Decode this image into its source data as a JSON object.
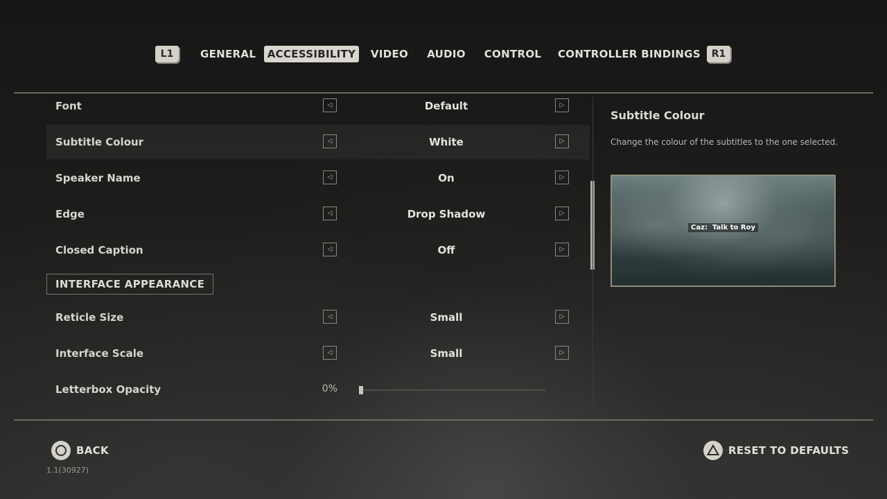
{
  "tabs": {
    "left_shoulder": "L1",
    "right_shoulder": "R1",
    "items": [
      {
        "label": "GENERAL"
      },
      {
        "label": "ACCESSIBILITY",
        "active": true
      },
      {
        "label": "VIDEO"
      },
      {
        "label": "AUDIO"
      },
      {
        "label": "CONTROL"
      },
      {
        "label": "CONTROLLER BINDINGS"
      }
    ]
  },
  "settings": {
    "font": {
      "label": "Font",
      "value": "Default"
    },
    "subtitle_colour": {
      "label": "Subtitle Colour",
      "value": "White",
      "selected": true
    },
    "speaker_name": {
      "label": "Speaker Name",
      "value": "On"
    },
    "edge": {
      "label": "Edge",
      "value": "Drop Shadow"
    },
    "closed_caption": {
      "label": "Closed Caption",
      "value": "Off"
    },
    "section_interface": "INTERFACE APPEARANCE",
    "reticle_size": {
      "label": "Reticle Size",
      "value": "Small"
    },
    "interface_scale": {
      "label": "Interface Scale",
      "value": "Small"
    },
    "letterbox_opacity": {
      "label": "Letterbox Opacity",
      "value": "0%",
      "level": 0.0
    }
  },
  "info": {
    "title": "Subtitle Colour",
    "description": "Change the colour of the subtitles to the one selected.",
    "preview_speaker": "Caz:",
    "preview_line": "Talk to Roy"
  },
  "footer": {
    "back_label": "BACK",
    "back_icon": "circle-button-icon",
    "reset_label": "RESET TO DEFAULTS",
    "reset_icon": "triangle-button-icon",
    "version": "1.1(30927)"
  },
  "colors": {
    "accent_tab": "#d8d6cf",
    "text": "#dcdad2",
    "rule": "#6d6b63"
  }
}
